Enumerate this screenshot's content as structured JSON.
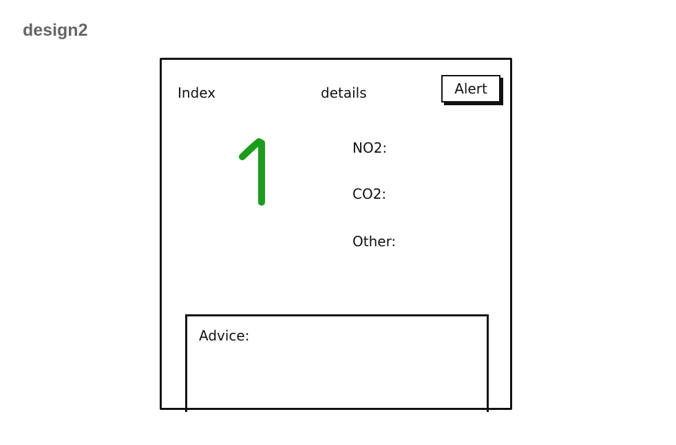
{
  "page": {
    "label": "design2"
  },
  "header": {
    "index_label": "Index",
    "details_label": "details",
    "alert_button": "Alert"
  },
  "index": {
    "value": "1",
    "color": "#1a9e1a"
  },
  "details": {
    "no2_label": "NO2:",
    "co2_label": "CO2:",
    "other_label": "Other:"
  },
  "advice": {
    "label": "Advice:"
  }
}
